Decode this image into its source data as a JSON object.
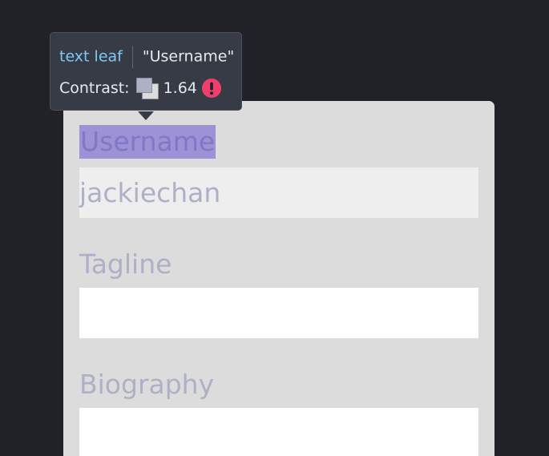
{
  "form": {
    "username_label": "Username",
    "username_value": "jackiechan",
    "tagline_label": "Tagline",
    "tagline_value": "",
    "biography_label": "Biography",
    "biography_value": ""
  },
  "inspector": {
    "node_kind": "text leaf",
    "node_text": "\"Username\"",
    "contrast_label": "Contrast:",
    "contrast_ratio": "1.64",
    "contrast_warning_icon": "exclamation-circle-icon",
    "swatch_foreground": "#aeb0c6",
    "swatch_background": "#dcdcdc"
  },
  "colors": {
    "page_background": "#212128",
    "card_background": "#dcdcdc",
    "label_text": "#aeb0c6",
    "highlight_overlay": "#9d92d6",
    "tooltip_background": "#373b46",
    "tooltip_kind_text": "#7cc9f5",
    "warning": "#ef3f6e"
  }
}
